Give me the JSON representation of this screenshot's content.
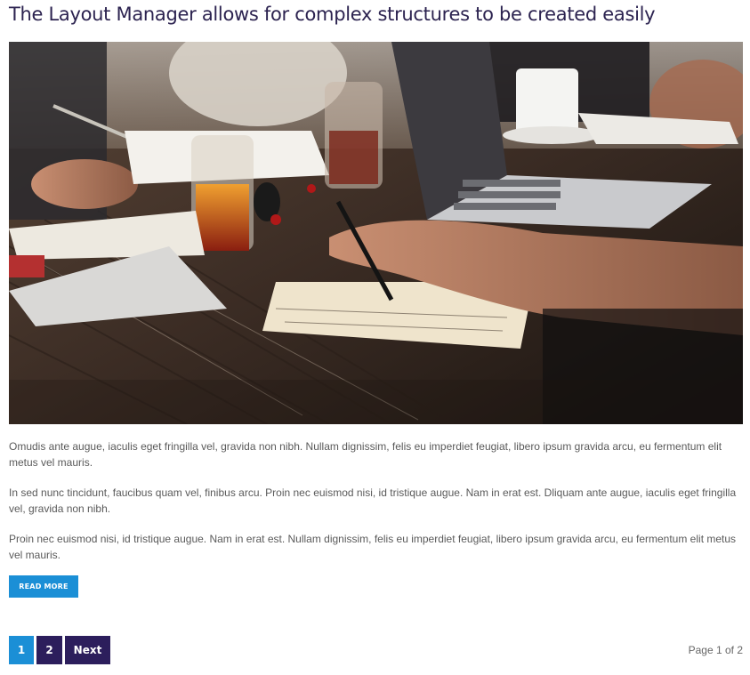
{
  "post": {
    "title": "The Layout Manager allows for complex structures to be created easily",
    "paragraphs": [
      "Omudis ante augue, iaculis eget fringilla vel, gravida non nibh. Nullam dignissim, felis eu imperdiet feugiat, libero ipsum gravida arcu, eu fermentum elit metus vel mauris.",
      "In sed nunc tincidunt, faucibus quam vel, finibus arcu. Proin nec euismod nisi, id tristique augue. Nam in erat est. Dliquam ante augue, iaculis eget fringilla vel, gravida non nibh.",
      "Proin nec euismod nisi, id tristique augue. Nam in erat est. Nullam dignissim, felis eu imperdiet feugiat, libero ipsum gravida arcu, eu fermentum elit metus vel mauris."
    ],
    "read_more_label": "READ MORE"
  },
  "pagination": {
    "pages": [
      "1",
      "2"
    ],
    "current_page": "1",
    "next_label": "Next",
    "page_count_text": "Page 1 of 2"
  },
  "colors": {
    "title": "#2c2350",
    "accent": "#1b8fd6",
    "pager_dark": "#2c1e5c"
  }
}
